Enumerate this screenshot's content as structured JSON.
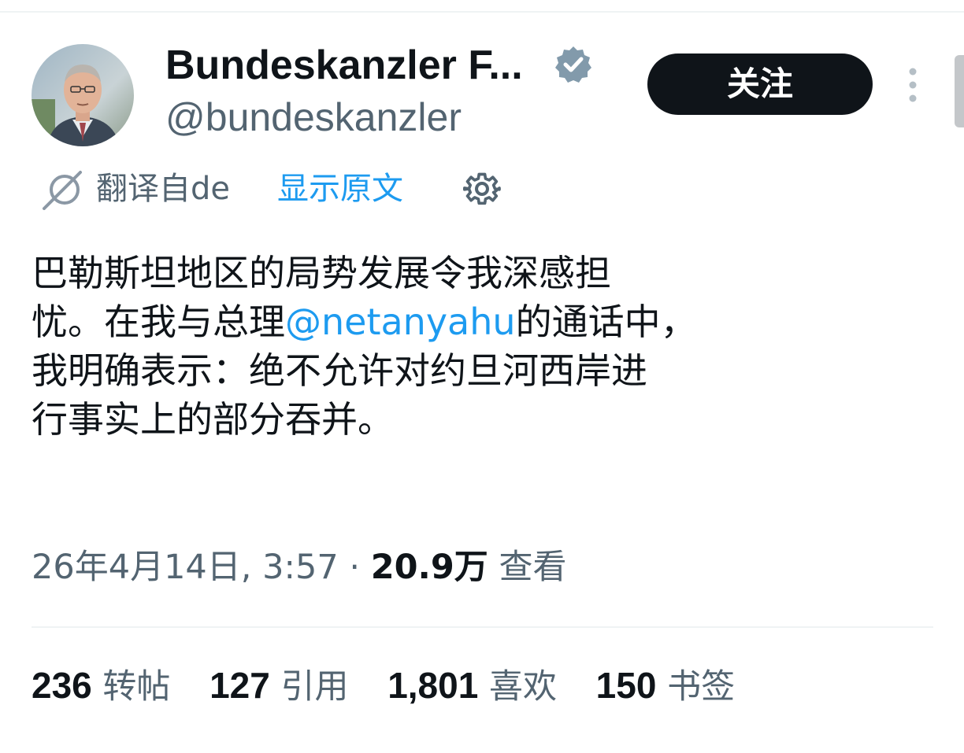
{
  "author": {
    "display_name": "Bundeskanzler F...",
    "handle": "@bundeskanzler",
    "verified_icon": "verified-badge-icon",
    "avatar": "profile-photo"
  },
  "follow_button": {
    "label": "关注"
  },
  "more_icon": "vertical-ellipsis-icon",
  "translation": {
    "icon": "translate-icon",
    "label": "翻译自de",
    "show_original": "显示原文",
    "settings_icon": "gear-icon"
  },
  "tweet": {
    "line1": "巴勒斯坦地区的局势发展令我深感担",
    "line2_before": "忧。在我与总理",
    "mention": "@netanyahu",
    "line2_after": "的通话中，",
    "line3": "我明确表示：绝不允许对约旦河西岸进",
    "line4": "行事实上的部分吞并。"
  },
  "meta": {
    "timestamp": "26年4月14日, 3:57",
    "separator": " · ",
    "views_count": "20.9万",
    "views_label": "查看"
  },
  "stats": [
    {
      "count": "236",
      "label": "转帖"
    },
    {
      "count": "127",
      "label": "引用"
    },
    {
      "count": "1,801",
      "label": "喜欢"
    },
    {
      "count": "150",
      "label": "书签"
    }
  ],
  "colors": {
    "text": "#0f1419",
    "secondary": "#536471",
    "link": "#1d9bf0",
    "button_bg": "#0f1419",
    "divider": "#eff3f4"
  }
}
